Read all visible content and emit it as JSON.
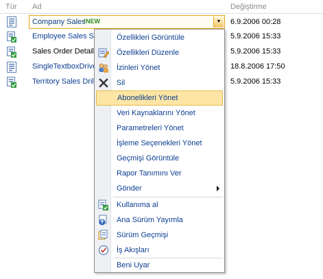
{
  "header": {
    "type_col": "Tür",
    "name_col": "Ad",
    "modified_col": "Değiştirme"
  },
  "rows": [
    {
      "name": "Company Sales",
      "badge": "!NEW",
      "date": "6.9.2006 00:28"
    },
    {
      "name": "Employee Sales Su",
      "date": "5.9.2006 15:33"
    },
    {
      "name": "Sales Order Detail",
      "date": "5.9.2006 15:33"
    },
    {
      "name": "SingleTextboxDrive",
      "date": "18.8.2006 17:50"
    },
    {
      "name": "Territory Sales Drill",
      "date": "5.9.2006 15:33"
    }
  ],
  "menu": {
    "items": [
      {
        "label": "Özellikleri Görüntüle",
        "icon": "none"
      },
      {
        "label": "Özellikleri Düzenle",
        "icon": "edit-properties-icon"
      },
      {
        "label": "İzinleri Yönet",
        "icon": "permissions-icon"
      },
      {
        "label": "Sil",
        "icon": "delete-icon"
      },
      {
        "label": "Abonelikleri Yönet",
        "icon": "none",
        "highlighted": true
      },
      {
        "label": "Veri Kaynaklarını Yönet",
        "icon": "none"
      },
      {
        "label": "Parametreleri Yönet",
        "icon": "none"
      },
      {
        "label": "İşleme Seçenekleri Yönet",
        "icon": "none"
      },
      {
        "label": "Geçmişi Görüntüle",
        "icon": "none"
      },
      {
        "label": "Rapor Tanımını Ver",
        "icon": "none"
      },
      {
        "label": "Gönder",
        "icon": "none",
        "submenu": true
      },
      {
        "label": "Kullanıma al",
        "icon": "checkout-icon"
      },
      {
        "label": "Ana Sürüm Yayımla",
        "icon": "publish-icon"
      },
      {
        "label": "Sürüm Geçmişi",
        "icon": "version-history-icon"
      },
      {
        "label": "İş Akışları",
        "icon": "workflow-icon"
      },
      {
        "label": "Beni Uyar",
        "icon": "none"
      }
    ]
  },
  "colors": {
    "link": "#0b3d91",
    "highlight": "#fde6a5",
    "highlight_border": "#e6b94a",
    "new_badge": "#2e8b22"
  }
}
